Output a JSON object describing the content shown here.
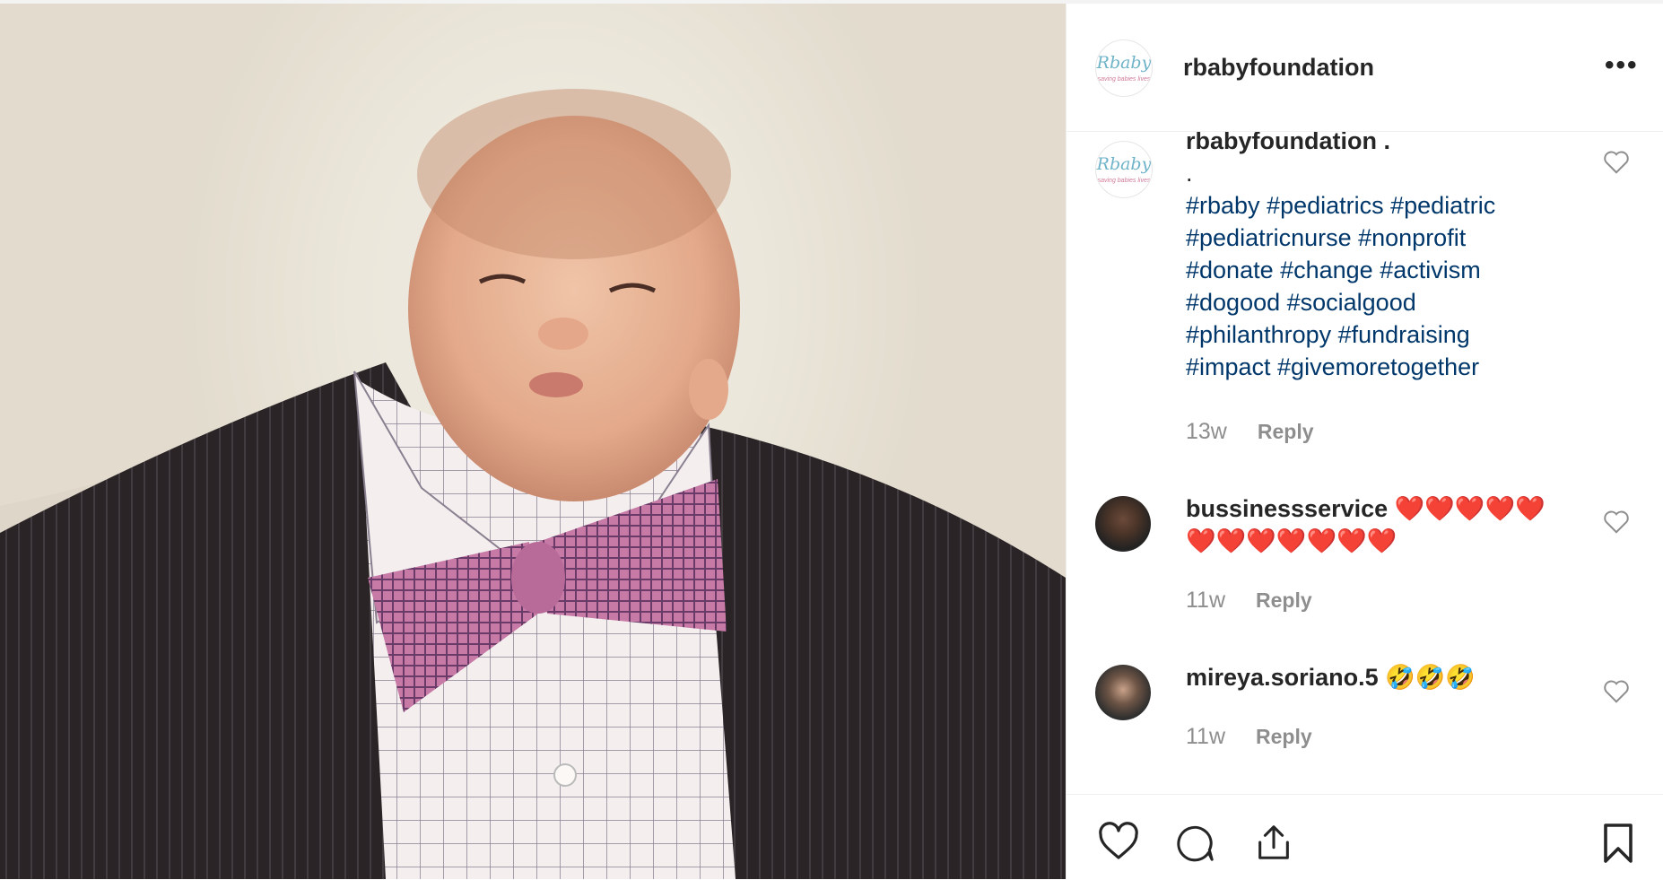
{
  "post": {
    "username": "rbabyfoundation",
    "more_icon": "more-options-icon",
    "logo_text": "Rbaby",
    "logo_tagline": "saving babies lives"
  },
  "comments": [
    {
      "username": "rbabyfoundation",
      "text_suffix": " .",
      "line2": ".",
      "hashtags": [
        "#rbaby #pediatrics #pediatric",
        "#pediatricnurse #nonprofit",
        "#donate #change #activism",
        "#dogood #socialgood",
        "#philanthropy #fundraising",
        "#impact #givemoretogether"
      ],
      "time": "13w",
      "reply": "Reply"
    },
    {
      "username": "bussinessservice",
      "emoji_line1": " ❤️❤️❤️❤️❤️",
      "emoji_line2": "❤️❤️❤️❤️❤️❤️❤️",
      "time": "11w",
      "reply": "Reply"
    },
    {
      "username": "mireya.soriano.5",
      "emoji_line1": " 🤣🤣🤣",
      "time": "11w",
      "reply": "Reply"
    }
  ],
  "actions": [
    "like-icon",
    "comment-icon",
    "share-icon",
    "save-icon"
  ],
  "colors": {
    "hashtag": "#00376b",
    "muted": "#8e8e8e",
    "text": "#262626"
  }
}
